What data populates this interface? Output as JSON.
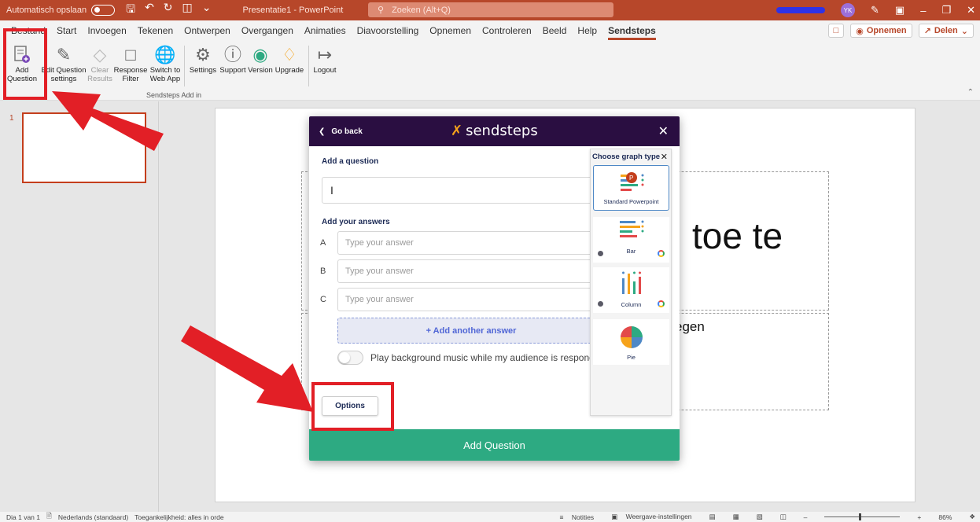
{
  "titlebar": {
    "autosave_label": "Automatisch opslaan",
    "doc_title": "Presentatie1  -  PowerPoint",
    "search_placeholder": "Zoeken (Alt+Q)",
    "user_initials": "YK"
  },
  "menu": {
    "tabs": [
      "Bestand",
      "Start",
      "Invoegen",
      "Tekenen",
      "Ontwerpen",
      "Overgangen",
      "Animaties",
      "Diavoorstelling",
      "Opnemen",
      "Controleren",
      "Beeld",
      "Help",
      "Sendsteps"
    ],
    "active_tab": "Sendsteps",
    "record_label": "Opnemen",
    "share_label": "Delen"
  },
  "ribbon": {
    "group_label": "Sendsteps Add in",
    "buttons": [
      {
        "label1": "Add",
        "label2": "Question"
      },
      {
        "label1": "Edit Question",
        "label2": "settings"
      },
      {
        "label1": "Clear",
        "label2": "Results"
      },
      {
        "label1": "Response",
        "label2": "Filter"
      },
      {
        "label1": "Switch to",
        "label2": "Web App"
      },
      {
        "label1": "Settings",
        "label2": ""
      },
      {
        "label1": "Support",
        "label2": ""
      },
      {
        "label1": "Version",
        "label2": ""
      },
      {
        "label1": "Upgrade",
        "label2": ""
      },
      {
        "label1": "Logout",
        "label2": ""
      }
    ]
  },
  "slides": {
    "current_number": "1"
  },
  "slide": {
    "title_fragment": "toe te",
    "body_fragment": "egen"
  },
  "dialog": {
    "go_back": "Go back",
    "brand": "sendsteps",
    "add_question_label": "Add a question",
    "question_value": "I",
    "answers_label": "Add your answers",
    "answers": [
      {
        "letter": "A",
        "placeholder": "Type your answer"
      },
      {
        "letter": "B",
        "placeholder": "Type your answer"
      },
      {
        "letter": "C",
        "placeholder": "Type your answer"
      }
    ],
    "add_answer": "+ Add another answer",
    "music_label": "Play background music while my audience is responding",
    "options": "Options",
    "submit": "Add Question"
  },
  "graph_panel": {
    "title": "Choose graph type",
    "types": [
      "Standard Powerpoint",
      "Bar",
      "Column",
      "Pie"
    ],
    "selected": "Standard Powerpoint"
  },
  "statusbar": {
    "slide_info": "Dia 1 van 1",
    "language": "Nederlands (standaard)",
    "accessibility": "Toegankelijkheid: alles in orde",
    "notes": "Notities",
    "view_settings": "Weergave-instellingen",
    "zoom": "86%"
  },
  "colors": {
    "accent": "#b7472a",
    "dialog_header": "#2a0e41",
    "submit": "#2daa82",
    "annotation": "#e21f26"
  }
}
